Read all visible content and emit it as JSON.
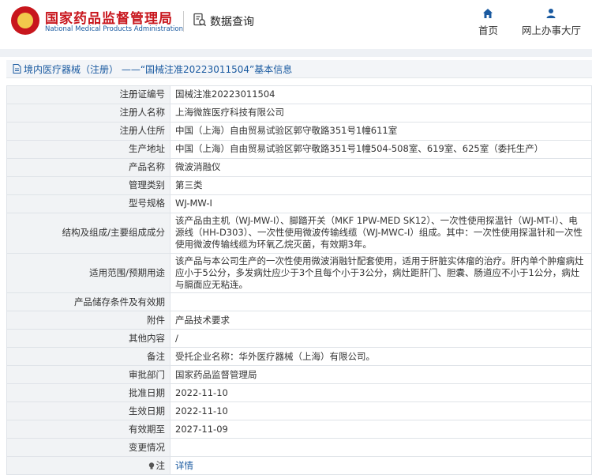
{
  "header": {
    "brand_cn": "国家药品监督管理局",
    "brand_en": "National Medical Products Administration",
    "search_label": "数据查询",
    "nav": [
      {
        "label": "首页",
        "icon": "home-icon"
      },
      {
        "label": "网上办事大厅",
        "icon": "user-icon"
      }
    ]
  },
  "breadcrumb": {
    "text": "境内医疗器械（注册） ——“国械注准20223011504”基本信息"
  },
  "rows": [
    {
      "label": "注册证编号",
      "value": "国械注准20223011504"
    },
    {
      "label": "注册人名称",
      "value": "上海微旌医疗科技有限公司"
    },
    {
      "label": "注册人住所",
      "value": "中国（上海）自由贸易试验区郭守敬路351号1幢611室"
    },
    {
      "label": "生产地址",
      "value": "中国（上海）自由贸易试验区郭守敬路351号1幢504-508室、619室、625室（委托生产）"
    },
    {
      "label": "产品名称",
      "value": "微波消融仪"
    },
    {
      "label": "管理类别",
      "value": "第三类"
    },
    {
      "label": "型号规格",
      "value": "WJ-MW-I"
    },
    {
      "label": "结构及组成/主要组成成分",
      "value": "该产品由主机（WJ-MW-I）、脚踏开关（MKF 1PW-MED SK12）、一次性使用探温针（WJ-MT-I）、电源线（HH-D303）、一次性使用微波传输线缆（WJ-MWC-I）组成。其中：一次性使用探温针和一次性使用微波传输线缆为环氧乙烷灭菌，有效期3年。"
    },
    {
      "label": "适用范围/预期用途",
      "value": "该产品与本公司生产的一次性使用微波消融针配套使用，适用于肝脏实体瘤的治疗。肝内单个肿瘤病灶应小于5公分，多发病灶应少于3个且每个小于3公分，病灶距肝门、胆囊、肠道应不小于1公分，病灶与膈面应无粘连。"
    },
    {
      "label": "产品储存条件及有效期",
      "value": ""
    },
    {
      "label": "附件",
      "value": "产品技术要求"
    },
    {
      "label": "其他内容",
      "value": "/"
    },
    {
      "label": "备注",
      "value": "受托企业名称：华外医疗器械（上海）有限公司。"
    },
    {
      "label": "审批部门",
      "value": "国家药品监督管理局"
    },
    {
      "label": "批准日期",
      "value": "2022-11-10"
    },
    {
      "label": "生效日期",
      "value": "2022-11-10"
    },
    {
      "label": "有效期至",
      "value": "2027-11-09"
    },
    {
      "label": "变更情况",
      "value": ""
    }
  ],
  "note_row": {
    "label": "注",
    "link": "详情"
  }
}
